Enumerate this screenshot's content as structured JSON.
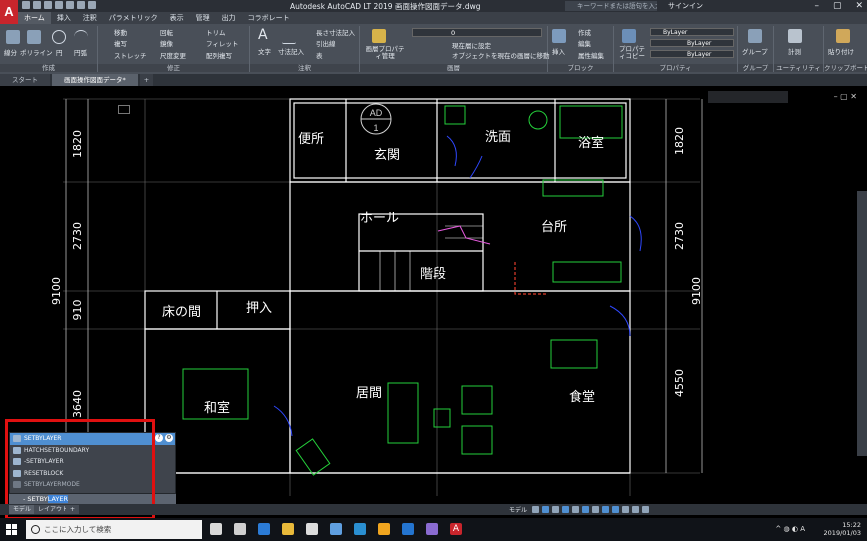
{
  "app": {
    "window_title": "Autodesk AutoCAD LT 2019  画面操作図面データ.dwg",
    "search_placeholder": "キーワードまたは語句を入力",
    "signin": "サインイン"
  },
  "ribbon_tabs": [
    "ホーム",
    "挿入",
    "注釈",
    "パラメトリック",
    "表示",
    "管理",
    "出力",
    "コラボレート"
  ],
  "ribbon": {
    "draw_label": "作成",
    "modify_label": "修正",
    "annotation_label": "注釈",
    "layer_label": "画層",
    "block_label": "ブロック",
    "properties_label": "プロパティ",
    "group_label": "グループ",
    "utility_label": "ユーティリティ",
    "clipboard_label": "クリップボード",
    "buttons": {
      "line": "線分",
      "polyline": "ポリライン",
      "circle": "円",
      "arc": "円弧",
      "move": "移動",
      "rotate": "回転",
      "trim": "トリム",
      "copy": "複写",
      "mirror": "鏡像",
      "fillet": "フィレット",
      "stretch": "ストレッチ",
      "scale": "尺度変更",
      "array": "配列複写",
      "text": "文字",
      "dimension": "寸法記入",
      "linear": "長さ寸法記入",
      "leader": "引出線",
      "table": "表",
      "layer_props": "画層プロパティ管理",
      "set_current": "現在層に設定",
      "match_layer": "オブジェクトを現在の画層に移動",
      "insert": "挿入",
      "create": "作成",
      "edit": "編集",
      "edit_attr": "属性編集",
      "prop_copy": "プロパティコピー",
      "bylayer1": "ByLayer",
      "bylayer2": "ByLayer",
      "bylayer3": "ByLayer",
      "group": "グループ",
      "measure": "計測",
      "paste": "貼り付け",
      "layer_value": "0"
    }
  },
  "file_tabs": [
    "スタート",
    "画面操作図面データ*"
  ],
  "drawing": {
    "rooms": {
      "toilet": "便所",
      "entrance": "玄関",
      "washroom": "洗面",
      "bathroom": "浴室",
      "hall": "ホール",
      "kitchen": "台所",
      "stairs": "階段",
      "tokonoma": "床の間",
      "closet": "押入",
      "washitsu": "和室",
      "living": "居間",
      "dining": "食堂"
    },
    "left_dims": [
      "1820",
      "2730",
      "910",
      "3640"
    ],
    "left_total": "9100",
    "right_dims": [
      "1820",
      "2730",
      "4550"
    ],
    "right_total": "9100",
    "marker_top": "AD",
    "marker_bottom": "1"
  },
  "command_palette": {
    "items": [
      "SETBYLAYER",
      "HATCHSETBOUNDARY",
      "-SETBYLAYER",
      "RESETBLOCK",
      "SETBYLAYERMODE"
    ],
    "prompt_prefix": "- SETBY",
    "prompt_highlight": "LAYER"
  },
  "layout_tabs": [
    "モデル",
    "レイアウト1"
  ],
  "status_bar": {
    "model_label": "モデル"
  },
  "taskbar": {
    "search_placeholder": "ここに入力して検索",
    "time": "15:22",
    "date": "2019/01/03",
    "ime": "A"
  }
}
